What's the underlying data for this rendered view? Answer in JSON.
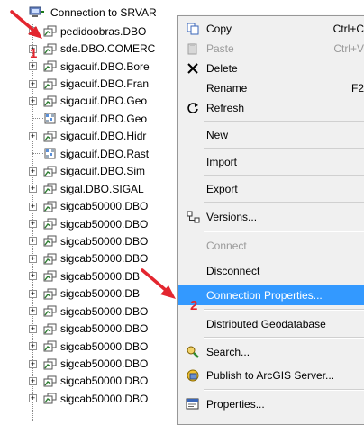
{
  "tree": {
    "connection_label": "Connection to SRVAR",
    "items": [
      {
        "label": "pedidoobras.DBO",
        "icon": "feature-class-icon"
      },
      {
        "label": "sde.DBO.COMERC",
        "icon": "feature-class-icon"
      },
      {
        "label": "sigacuif.DBO.Bore",
        "icon": "feature-class-icon"
      },
      {
        "label": "sigacuif.DBO.Fran",
        "icon": "feature-class-icon"
      },
      {
        "label": "sigacuif.DBO.Geo",
        "icon": "feature-class-icon"
      },
      {
        "label": "sigacuif.DBO.Geo",
        "icon": "raster-icon"
      },
      {
        "label": "sigacuif.DBO.Hidr",
        "icon": "feature-class-icon"
      },
      {
        "label": "sigacuif.DBO.Rast",
        "icon": "raster-icon"
      },
      {
        "label": "sigacuif.DBO.Sim",
        "icon": "feature-class-icon"
      },
      {
        "label": "sigal.DBO.SIGAL",
        "icon": "feature-class-icon"
      },
      {
        "label": "sigcab50000.DBO",
        "icon": "feature-class-icon"
      },
      {
        "label": "sigcab50000.DBO",
        "icon": "feature-class-icon"
      },
      {
        "label": "sigcab50000.DBO",
        "icon": "feature-class-icon"
      },
      {
        "label": "sigcab50000.DBO",
        "icon": "feature-class-icon"
      },
      {
        "label": "sigcab50000.DB",
        "icon": "feature-class-icon"
      },
      {
        "label": "sigcab50000.DB",
        "icon": "feature-class-icon"
      },
      {
        "label": "sigcab50000.DBO",
        "icon": "feature-class-icon"
      },
      {
        "label": "sigcab50000.DBO",
        "icon": "feature-class-icon"
      },
      {
        "label": "sigcab50000.DBO",
        "icon": "feature-class-icon"
      },
      {
        "label": "sigcab50000.DBO",
        "icon": "feature-class-icon"
      },
      {
        "label": "sigcab50000.DBO",
        "icon": "feature-class-icon"
      },
      {
        "label": "sigcab50000.DBO",
        "icon": "feature-class-icon"
      }
    ]
  },
  "menu": {
    "copy": {
      "label": "Copy",
      "shortcut": "Ctrl+C"
    },
    "paste": {
      "label": "Paste",
      "shortcut": "Ctrl+V"
    },
    "delete": {
      "label": "Delete"
    },
    "rename": {
      "label": "Rename",
      "shortcut": "F2"
    },
    "refresh": {
      "label": "Refresh"
    },
    "new": {
      "label": "New"
    },
    "import": {
      "label": "Import"
    },
    "export": {
      "label": "Export"
    },
    "versions": {
      "label": "Versions..."
    },
    "connect": {
      "label": "Connect"
    },
    "disconnect": {
      "label": "Disconnect"
    },
    "connection_properties": {
      "label": "Connection Properties..."
    },
    "distributed_geodatabase": {
      "label": "Distributed Geodatabase"
    },
    "search": {
      "label": "Search..."
    },
    "publish": {
      "label": "Publish to ArcGIS Server..."
    },
    "properties": {
      "label": "Properties..."
    }
  },
  "annotations": {
    "step1": "1",
    "step2": "2",
    "color": "#e3262f"
  },
  "colors": {
    "selection": "#3399ff",
    "menu_bg": "#f0f0f0"
  }
}
